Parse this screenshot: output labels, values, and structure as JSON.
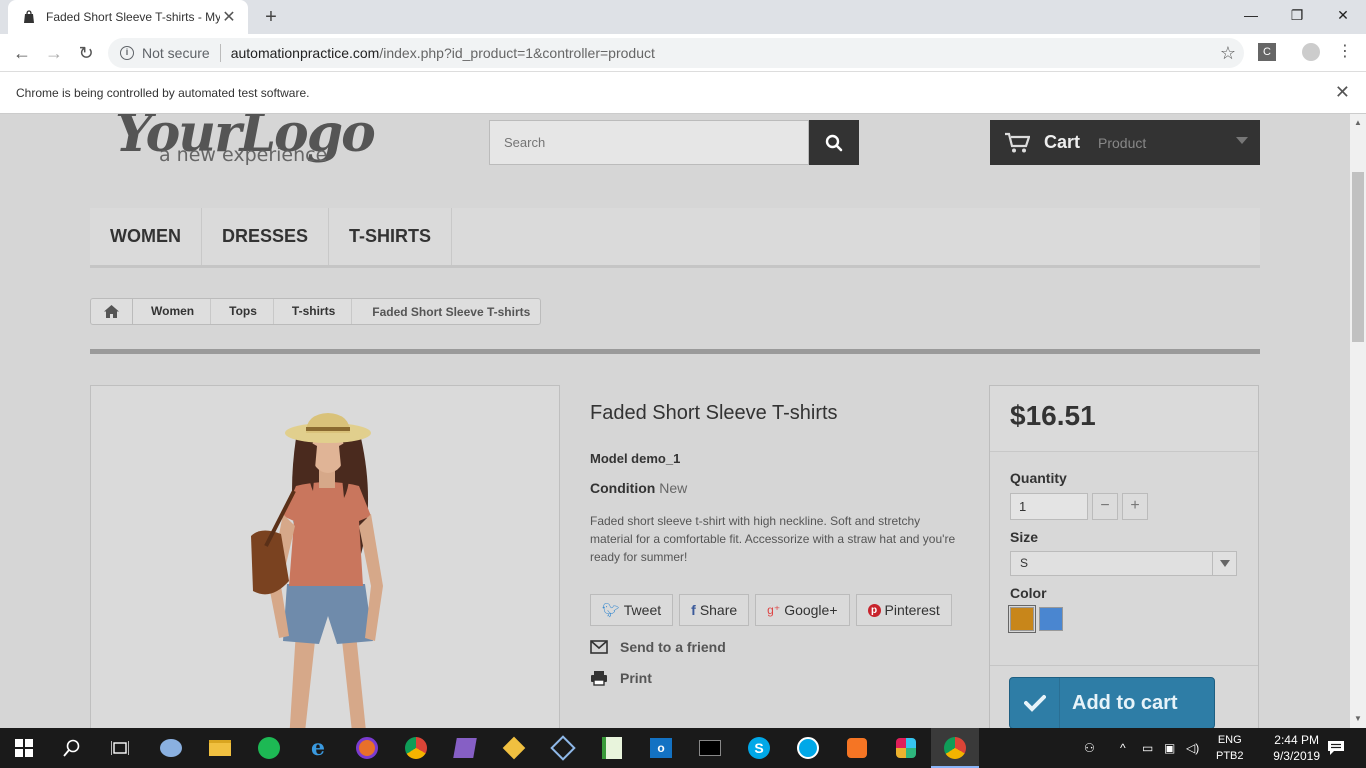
{
  "browser": {
    "tab_title": "Faded Short Sleeve T-shirts - My",
    "security_label": "Not secure",
    "url_domain": "automationpractice.com",
    "url_path": "/index.php?id_product=1&controller=product",
    "infobar_text": "Chrome is being controlled by automated test software.",
    "ext_label": "C"
  },
  "header": {
    "logo_main": "YourLogo",
    "logo_sub": "a new experience",
    "search_placeholder": "Search",
    "cart_label": "Cart",
    "cart_subtitle": "Product"
  },
  "menu": [
    "WOMEN",
    "DRESSES",
    "T-SHIRTS"
  ],
  "breadcrumb": [
    "Women",
    "Tops",
    "T-shirts",
    "Faded Short Sleeve T-shirts"
  ],
  "product": {
    "title": "Faded Short Sleeve T-shirts",
    "model_label": "Model demo_1",
    "condition_label": "Condition",
    "condition_value": "New",
    "description": "Faded short sleeve t-shirt with high neckline. Soft and stretchy material for a comfortable fit. Accessorize with a straw hat and you're ready for summer!",
    "social": {
      "tweet": "Tweet",
      "share": "Share",
      "google": "Google+",
      "pinterest": "Pinterest"
    },
    "send_friend": "Send to a friend",
    "print": "Print"
  },
  "buy": {
    "price": "$16.51",
    "quantity_label": "Quantity",
    "quantity_value": "1",
    "qty_minus": "−",
    "qty_plus": "+",
    "size_label": "Size",
    "size_value": "S",
    "color_label": "Color",
    "colors": [
      "#c8861a",
      "#4a86d0"
    ],
    "add_to_cart": "Add to cart"
  },
  "taskbar": {
    "lang": "ENG",
    "layout": "PTB2",
    "time": "2:44 PM",
    "date": "9/3/2019"
  }
}
